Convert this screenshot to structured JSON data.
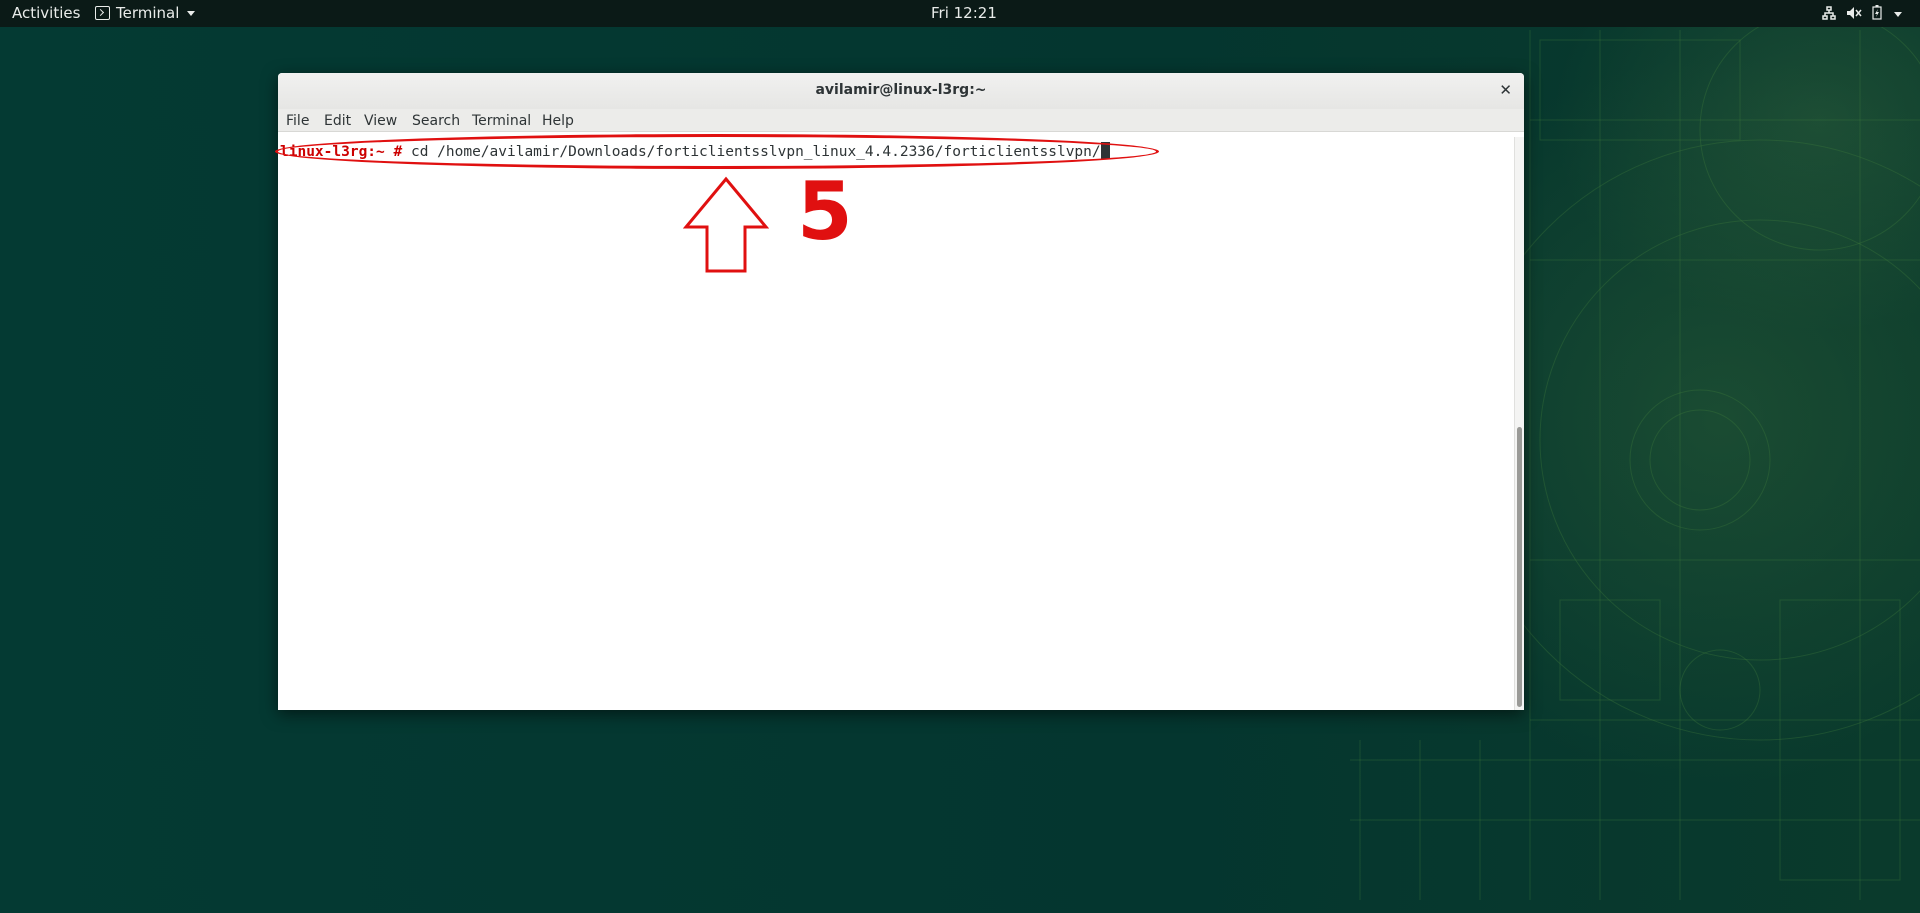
{
  "topbar": {
    "activities": "Activities",
    "app_name": "Terminal",
    "clock": "Fri 12:21",
    "status_icons": [
      "network-icon",
      "volume-muted-icon",
      "battery-icon",
      "system-menu-icon"
    ]
  },
  "window": {
    "title": "avilamir@linux-l3rg:~",
    "menu": [
      "File",
      "Edit",
      "View",
      "Search",
      "Terminal",
      "Help"
    ],
    "terminal": {
      "prompt_host": "linux-l3rg:~",
      "prompt_symbol": "#",
      "command": "cd /home/avilamir/Downloads/forticlientsslvpn_linux_4.4.2336/forticlientsslvpn/"
    }
  },
  "annotation": {
    "step_number": "5",
    "color": "#e01010"
  },
  "colors": {
    "desktop_bg": "#04362f",
    "topbar_bg": "#0b1a17",
    "prompt_red": "#cc0000"
  }
}
